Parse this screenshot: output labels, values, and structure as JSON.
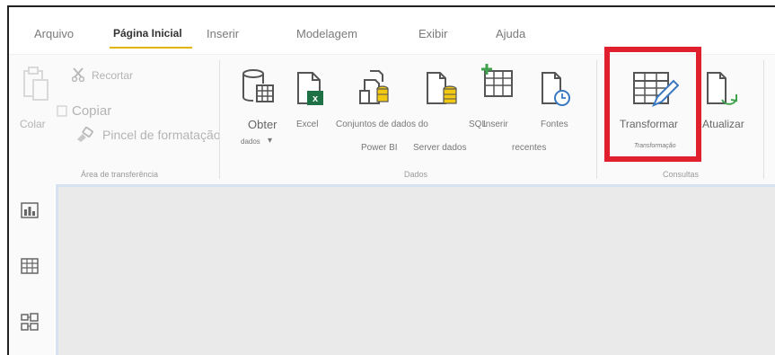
{
  "tabs": [
    {
      "label": "Arquivo"
    },
    {
      "label": "Página Inicial"
    },
    {
      "label": "Inserir"
    },
    {
      "label": "Modelagem"
    },
    {
      "label": "Exibir"
    },
    {
      "label": "Ajuda"
    }
  ],
  "clipboard": {
    "paste": "Colar",
    "cut": "Recortar",
    "copy": "Copiar",
    "format_painter": "Pincel de formatação",
    "group_label": "Área de transferência"
  },
  "data": {
    "get_data": "Obter",
    "get_data_sub": "dados",
    "excel": "Excel",
    "datasets_line1": "Conjuntos de dados do",
    "datasets_line2": "Power BI",
    "sql": "SQL",
    "enter_data_line1": "Inserir",
    "enter_data_line2": "Server dados",
    "recent_line1": "Fontes",
    "recent_line2": "recentes",
    "group_label": "Dados"
  },
  "queries": {
    "transform": "Transformar",
    "transform_sub": "Transformação",
    "refresh": "Atualizar",
    "group_label": "Consultas"
  },
  "sidebar": {
    "items": [
      {
        "icon": "report-view-icon"
      },
      {
        "icon": "data-view-icon"
      },
      {
        "icon": "model-view-icon"
      }
    ]
  },
  "colors": {
    "highlight": "#e0202c",
    "tab_underline": "#e2b400",
    "excel_green": "#1e7145",
    "canvas": "#eaeaea"
  }
}
